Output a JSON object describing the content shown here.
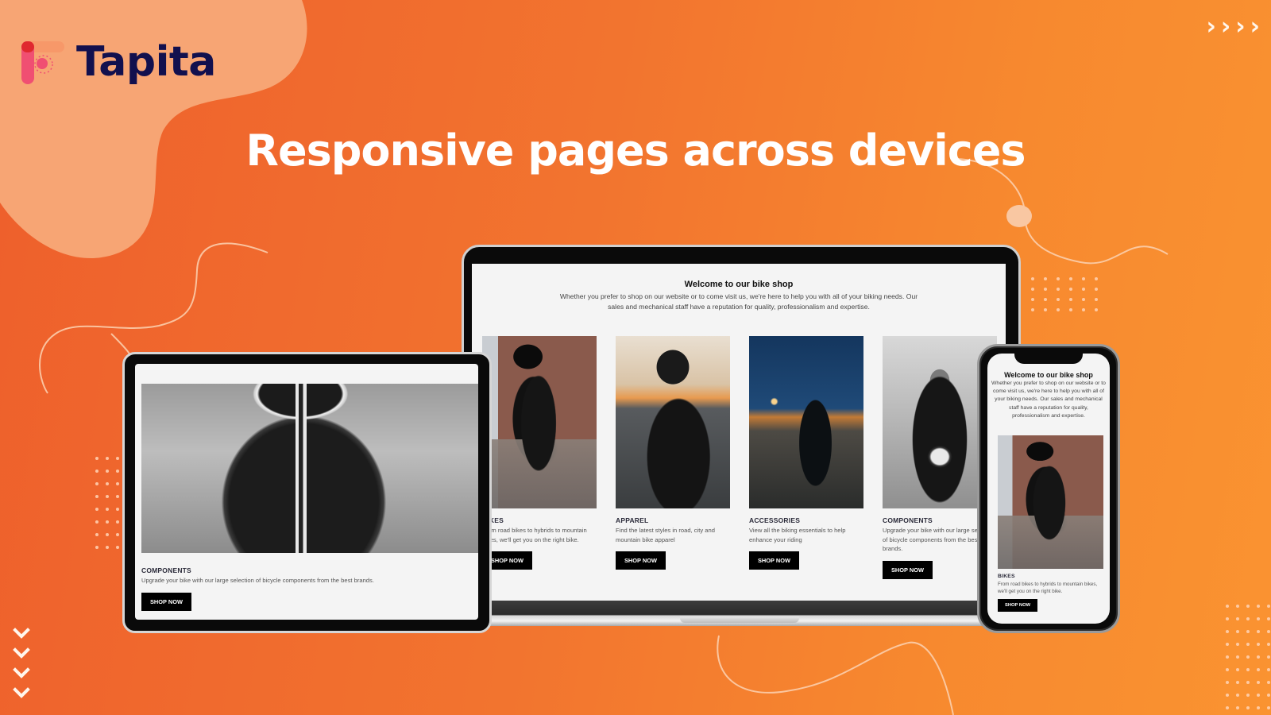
{
  "brand": {
    "name": "Tapita",
    "colors": {
      "background_start": "#ee5f2c",
      "background_end": "#fa9331",
      "blob": "#f7a574",
      "logo_text": "#12104e",
      "logo_mark_pink": "#f04f72",
      "logo_mark_red": "#e0282f",
      "headline": "#ffffff"
    }
  },
  "headline": "Responsive pages across devices",
  "decorations": {
    "chevrons_right": [
      "›",
      "›",
      "›",
      "›"
    ],
    "chevrons_down": [
      "⌄",
      "⌄",
      "⌄",
      "⌄"
    ]
  },
  "shop": {
    "title": "Welcome to our bike shop",
    "description": "Whether you prefer to shop on our website or to come visit us, we're here to help you with all of your biking needs. Our sales and mechanical staff have a reputation for quality, professionalism and expertise.",
    "button_label": "SHOP NOW",
    "categories": [
      {
        "title": "BIKES",
        "description": "From road bikes to hybrids to mountain bikes, we'll get you on the right bike.",
        "photo": "rider-on-motorbike-city"
      },
      {
        "title": "APPAREL",
        "description": "Find the latest styles in road, city and mountain bike apparel",
        "photo": "rider-in-leather-jacket-sunset"
      },
      {
        "title": "ACCESSORIES",
        "description": "View all the biking essentials to help enhance your riding",
        "photo": "rider-on-bridge-night"
      },
      {
        "title": "COMPONENTS",
        "description": "Upgrade your bike with our large selection of bicycle components from the best brands.",
        "photo": "rider-black-and-white"
      }
    ]
  },
  "devices": {
    "laptop": {
      "label": "laptop-mockup"
    },
    "tablet": {
      "featured_category_index": 3
    },
    "phone": {
      "featured_category_index": 0
    }
  }
}
